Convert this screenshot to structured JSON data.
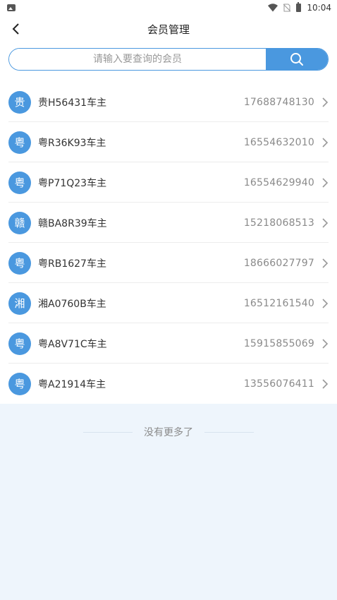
{
  "status_bar": {
    "time": "10:04"
  },
  "nav": {
    "title": "会员管理"
  },
  "search": {
    "placeholder": "请输入要查询的会员"
  },
  "members": [
    {
      "avatar": "贵",
      "plate": "贵H56431车主",
      "phone": "17688748130"
    },
    {
      "avatar": "粤",
      "plate": "粤R36K93车主",
      "phone": "16554632010"
    },
    {
      "avatar": "粤",
      "plate": "粤P71Q23车主",
      "phone": "16554629940"
    },
    {
      "avatar": "赣",
      "plate": "赣BA8R39车主",
      "phone": "15218068513"
    },
    {
      "avatar": "粤",
      "plate": "粤RB1627车主",
      "phone": "18666027797"
    },
    {
      "avatar": "湘",
      "plate": "湘A0760B车主",
      "phone": "16512161540"
    },
    {
      "avatar": "粤",
      "plate": "粤A8V71C车主",
      "phone": "15915855069"
    },
    {
      "avatar": "粤",
      "plate": "粤A21914车主",
      "phone": "13556076411"
    }
  ],
  "footer": {
    "text": "没有更多了"
  },
  "colors": {
    "accent": "#4a98df",
    "background": "#eef5fc"
  }
}
